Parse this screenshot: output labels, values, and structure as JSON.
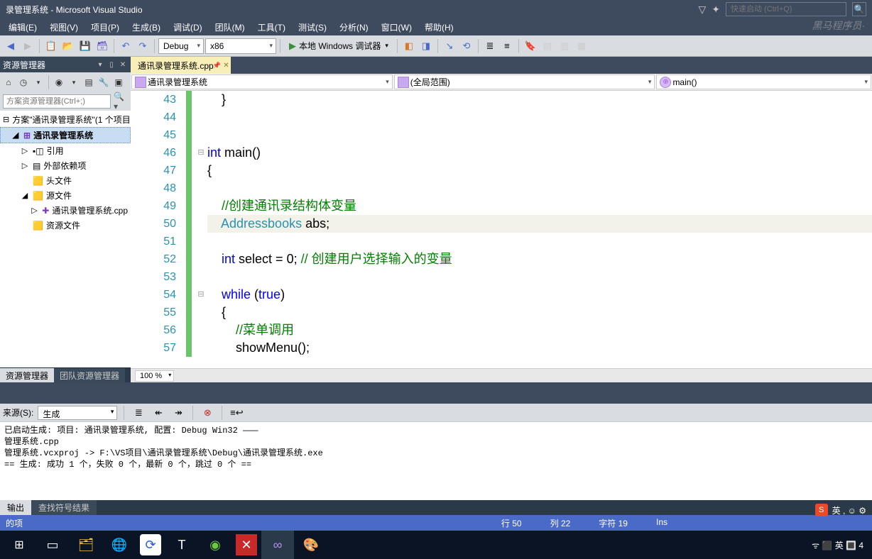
{
  "title": "录管理系统 - Microsoft Visual Studio",
  "watermark": "黑马程序员·",
  "quick_launch": {
    "placeholder": "快速启动 (Ctrl+Q)"
  },
  "menus": [
    "编辑(E)",
    "视图(V)",
    "项目(P)",
    "生成(B)",
    "调试(D)",
    "团队(M)",
    "工具(T)",
    "测试(S)",
    "分析(N)",
    "窗口(W)",
    "帮助(H)"
  ],
  "toolbar": {
    "config": "Debug",
    "platform": "x86",
    "debug_target": "本地 Windows 调试器"
  },
  "solution": {
    "panel_title": "资源管理器",
    "search_placeholder": "方案资源管理器(Ctrl+;)",
    "root": "方案\"通讯录管理系统\"(1 个项目)",
    "project": "通讯录管理系统",
    "items": [
      "引用",
      "外部依赖项",
      "头文件",
      "源文件",
      "通讯录管理系统.cpp",
      "资源文件"
    ],
    "tabs": [
      "资源管理器",
      "团队资源管理器"
    ]
  },
  "editor": {
    "tab": "通讯录管理系统.cpp",
    "nav_scope": "通讯录管理系统",
    "nav_global": "(全局范围)",
    "nav_func": "main()",
    "zoom": "100 %",
    "lines": [
      {
        "n": 43,
        "html": "    }"
      },
      {
        "n": 44,
        "html": ""
      },
      {
        "n": 45,
        "html": ""
      },
      {
        "n": 46,
        "html": "<span class='kw'>int</span> main()",
        "fold": "⊟"
      },
      {
        "n": 47,
        "html": "{"
      },
      {
        "n": 48,
        "html": "        "
      },
      {
        "n": 49,
        "html": "    <span class='cm'>//创建通讯录结构体变量</span>"
      },
      {
        "n": 50,
        "html": "    <span class='ty'>Addressbooks</span> abs;",
        "hl": true
      },
      {
        "n": 51,
        "html": ""
      },
      {
        "n": 52,
        "html": "    <span class='kw'>int</span> select = 0; <span class='cm'>// 创建用户选择输入的变量</span>"
      },
      {
        "n": 53,
        "html": ""
      },
      {
        "n": 54,
        "html": "    <span class='kw'>while</span> (<span class='kw'>true</span>)",
        "fold": "⊟"
      },
      {
        "n": 55,
        "html": "    {"
      },
      {
        "n": 56,
        "html": "        <span class='cm'>//菜单调用</span>"
      },
      {
        "n": 57,
        "html": "        showMenu();"
      }
    ]
  },
  "output": {
    "source_label": "来源(S):",
    "source_value": "生成",
    "text": "已启动生成: 项目: 通讯录管理系统, 配置: Debug Win32 ———\n管理系统.cpp\n管理系统.vcxproj -> F:\\VS项目\\通讯录管理系统\\Debug\\通讯录管理系统.exe\n== 生成: 成功 1 个，失败 0 个，最新 0 个，跳过 0 个 ==",
    "tabs": [
      "输出",
      "查找符号结果"
    ]
  },
  "statusbar": {
    "left": "的项",
    "line": "行 50",
    "col": "列 22",
    "ch": "字符 19",
    "ins": "Ins"
  },
  "ime": {
    "badge": "S",
    "text": "英 , ☺ ⚙"
  },
  "taskbar_right": "ᯤ ⬛ 英 🔳 4"
}
